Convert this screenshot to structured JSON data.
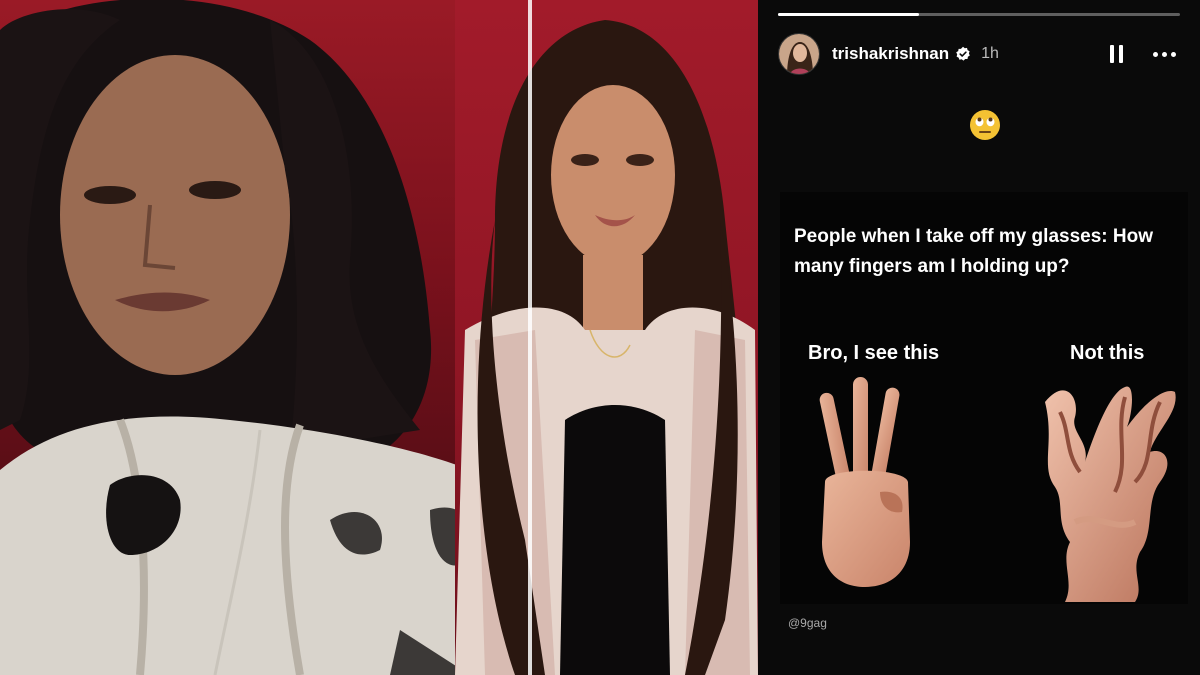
{
  "story": {
    "progress": 0.35,
    "username": "trishakrishnan",
    "time": "1h",
    "post_text": "People when I take off my glasses: How many fingers am I holding up?",
    "label_left": "Bro, I see this",
    "label_right": "Not this",
    "credit": "@9gag",
    "icons": {
      "pause": "pause-icon",
      "more": "more-icon",
      "verified": "verified-badge-icon",
      "emoji": "eye-roll-emoji"
    }
  },
  "colors": {
    "background_red": "#8c1020",
    "story_bg": "#0a0a0a",
    "verified": "#3b82f6"
  }
}
